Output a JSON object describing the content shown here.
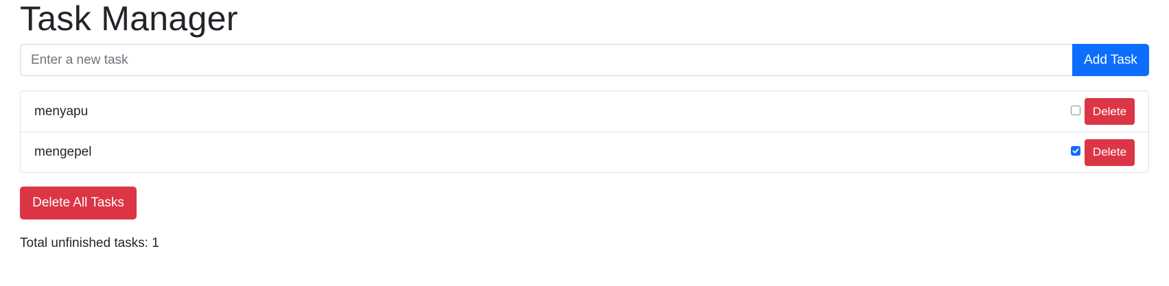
{
  "page": {
    "title": "Task Manager"
  },
  "new_task": {
    "placeholder": "Enter a new task",
    "value": "",
    "add_label": "Add Task"
  },
  "tasks": [
    {
      "name": "menyapu",
      "completed": false,
      "delete_label": "Delete"
    },
    {
      "name": "mengepel",
      "completed": true,
      "delete_label": "Delete"
    }
  ],
  "actions": {
    "delete_all_label": "Delete All Tasks"
  },
  "summary": {
    "text": "Total unfinished tasks: 1"
  },
  "colors": {
    "primary": "#0d6efd",
    "danger": "#dc3545",
    "border": "#dee2e6",
    "text": "#212529"
  },
  "icons": {
    "checkbox_checked": "check-icon"
  }
}
